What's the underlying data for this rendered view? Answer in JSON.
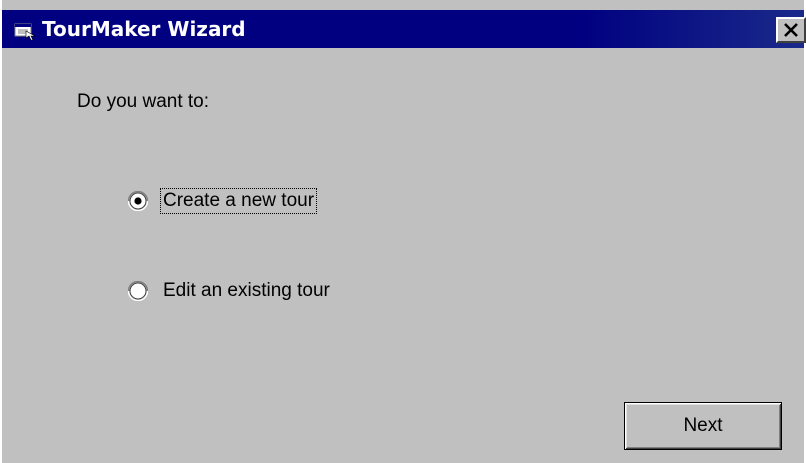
{
  "window": {
    "title": "TourMaker Wizard",
    "close_glyph": "✕",
    "colors": {
      "titlebar": "#000080",
      "face": "#c0c0c0",
      "title_text": "#ffffff"
    }
  },
  "prompt": {
    "text": "Do you want to:"
  },
  "options": [
    {
      "label": "Create a new tour",
      "selected": true,
      "focused": true
    },
    {
      "label": "Edit an existing tour",
      "selected": false,
      "focused": false
    }
  ],
  "buttons": {
    "next_label": "Next"
  },
  "icons": {
    "title": "app-window-icon",
    "close": "close-icon",
    "radio_on": "radio-selected-icon",
    "radio_off": "radio-unselected-icon"
  }
}
